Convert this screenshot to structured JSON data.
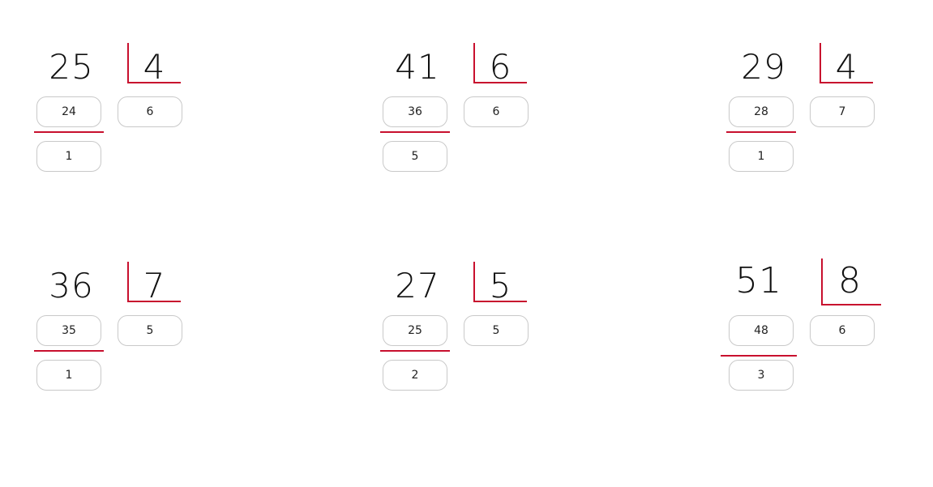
{
  "problems": [
    {
      "dividend": "25",
      "divisor": "4",
      "subtracted": "24",
      "quotient": "6",
      "remainder": "1"
    },
    {
      "dividend": "41",
      "divisor": "6",
      "subtracted": "36",
      "quotient": "6",
      "remainder": "5"
    },
    {
      "dividend": "29",
      "divisor": "4",
      "subtracted": "28",
      "quotient": "7",
      "remainder": "1"
    },
    {
      "dividend": "36",
      "divisor": "7",
      "subtracted": "35",
      "quotient": "5",
      "remainder": "1"
    },
    {
      "dividend": "27",
      "divisor": "5",
      "subtracted": "25",
      "quotient": "5",
      "remainder": "2"
    },
    {
      "dividend": "51",
      "divisor": "8",
      "subtracted": "48",
      "quotient": "6",
      "remainder": "3"
    }
  ],
  "colors": {
    "accent": "#c8102e",
    "field_border": "#c9c9c9",
    "text": "#111111"
  }
}
